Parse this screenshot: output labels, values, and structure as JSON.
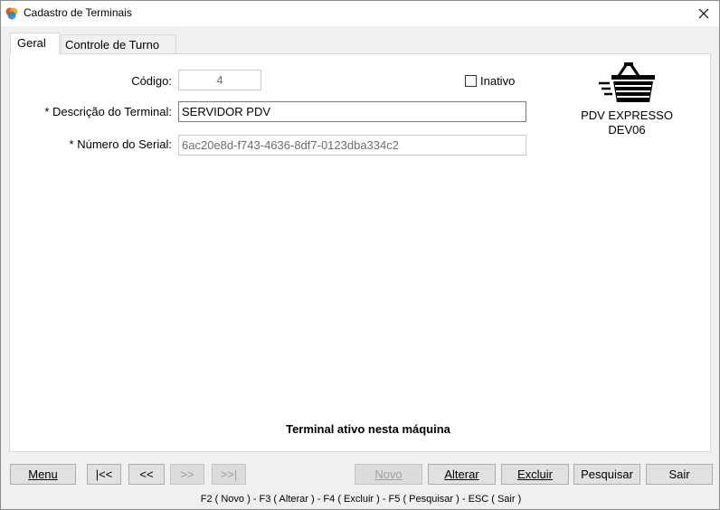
{
  "window": {
    "title": "Cadastro de Terminais",
    "close_glyph": "✕"
  },
  "tabs": [
    {
      "label": "Geral",
      "active": true
    },
    {
      "label": "Controle de Turno",
      "active": false
    }
  ],
  "form": {
    "codigo_label": "Código:",
    "codigo_value": "4",
    "descricao_label": "* Descrição do Terminal:",
    "descricao_value": "SERVIDOR PDV",
    "serial_label": "* Número do Serial:",
    "serial_value": "6ac20e8d-f743-4636-8df7-0123dba334c2",
    "inativo_label": "Inativo",
    "inativo_checked": false
  },
  "terminal_card": {
    "icon": "shopping-basket-icon",
    "line1": "PDV EXPRESSO",
    "line2": "DEV06"
  },
  "status_message": "Terminal ativo nesta máquina",
  "buttons": {
    "menu": "Menu",
    "first": "|<<",
    "prev": "<<",
    "next": ">>",
    "last": ">>|",
    "novo": "Novo",
    "alterar": "Alterar",
    "excluir": "Excluir",
    "pesquisar": "Pesquisar",
    "sair": "Sair"
  },
  "shortcuts": "F2 ( Novo )  -  F3 ( Alterar )  -  F4 ( Excluir )  -  F5 ( Pesquisar )  -  ESC ( Sair )",
  "colors": {
    "window_bg": "#f0f0f0",
    "panel_bg": "#ffffff",
    "button_bg": "#e1e1e1",
    "disabled_text": "#a0a0a0"
  }
}
